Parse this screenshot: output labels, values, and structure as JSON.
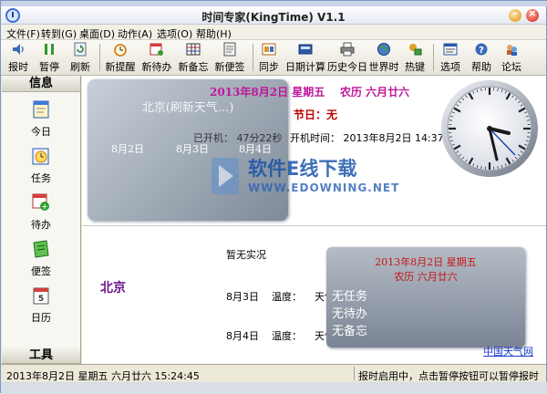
{
  "window": {
    "title": "时间专家(KingTime) V1.1"
  },
  "menu": [
    "文件(F)",
    "转到(G)",
    "桌面(D)",
    "动作(A)",
    "选项(O)",
    "帮助(H)"
  ],
  "toolbar": [
    {
      "label": "报时",
      "icon": "speaker-icon"
    },
    {
      "label": "暂停",
      "icon": "pause-icon"
    },
    {
      "label": "刷新",
      "icon": "refresh-icon"
    },
    {
      "label": "新提醒",
      "icon": "alarm-clock-icon"
    },
    {
      "label": "新待办",
      "icon": "calendar-add-icon"
    },
    {
      "label": "新备忘",
      "icon": "grid-note-icon"
    },
    {
      "label": "新便签",
      "icon": "note-icon"
    },
    {
      "label": "同步",
      "icon": "sync-icon"
    },
    {
      "label": "日期计算",
      "icon": "calculator-icon"
    },
    {
      "label": "历史今日",
      "icon": "printer-icon"
    },
    {
      "label": "世界时",
      "icon": "globe-icon"
    },
    {
      "label": "热键",
      "icon": "hotkey-icon"
    },
    {
      "label": "选项",
      "icon": "options-icon"
    },
    {
      "label": "帮助",
      "icon": "help-icon"
    },
    {
      "label": "论坛",
      "icon": "forum-icon"
    }
  ],
  "sidebar": {
    "header_info": "信息",
    "header_tools": "工具",
    "items": [
      {
        "label": "今日",
        "icon": "today-icon"
      },
      {
        "label": "任务",
        "icon": "task-icon"
      },
      {
        "label": "待办",
        "icon": "todo-icon"
      },
      {
        "label": "便签",
        "icon": "sticky-note-icon"
      },
      {
        "label": "日历",
        "icon": "calendar-icon"
      }
    ]
  },
  "calendar_panel": {
    "weather_title": "北京(刷新天气...)",
    "days": [
      "8月2日",
      "8月3日",
      "8月4日"
    ]
  },
  "info": {
    "date_week": "2013年8月2日  星期五",
    "lunar": "农历  六月廿六",
    "holiday": "节日：无",
    "uptime": "已开机： 47分22秒",
    "boot_time": "开机时间： 2013年8月2日 14:37"
  },
  "weather": {
    "city": "北京",
    "no_live": "暂无实况",
    "forecast": [
      {
        "day": "8月3日",
        "temp_label": "温度：",
        "weather_label": "天气："
      },
      {
        "day": "8月4日",
        "temp_label": "温度：",
        "weather_label": "天气："
      }
    ],
    "link": "中国天气网"
  },
  "task_panel": {
    "date_week": "2013年8月2日 星期五",
    "lunar": "农历  六月廿六",
    "items": [
      "无任务",
      "无待办",
      "无备忘"
    ]
  },
  "watermark": {
    "title": "软件E线下载",
    "url": "WWW.EDOWNING.NET"
  },
  "statusbar": {
    "datetime": "2013年8月2日   星期五    六月廿六    15:24:45",
    "hint": "报时启用中，点击暂停按钮可以暂停报时"
  },
  "colors": {
    "accent_magenta": "#c0169a",
    "holiday_red": "#c00000",
    "city_purple": "#6a1a8a",
    "panel_slate": "#7a8494"
  }
}
